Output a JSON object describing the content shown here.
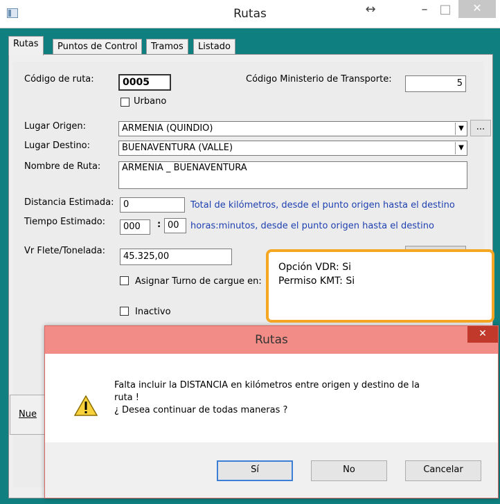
{
  "window": {
    "title": "Rutas",
    "resize_glyph": "↔",
    "minimize_glyph": "–",
    "maximize_glyph": "□",
    "close_glyph": "✕"
  },
  "tabs": [
    {
      "label": "Rutas"
    },
    {
      "label": "Puntos de Control"
    },
    {
      "label": "Tramos"
    },
    {
      "label": "Listado"
    }
  ],
  "form": {
    "codigo_ruta_label": "Código de ruta:",
    "codigo_ruta_value": "0005",
    "codigo_ministerio_label": "Código Ministerio de Transporte:",
    "codigo_ministerio_value": "5",
    "urbano_label": "Urbano",
    "lugar_origen_label": "Lugar Origen:",
    "lugar_origen_value": "ARMENIA  (QUINDIO)",
    "ellipsis_label": "...",
    "lugar_destino_label": "Lugar Destino:",
    "lugar_destino_value": "BUENAVENTURA  (VALLE)",
    "nombre_ruta_label": "Nombre de Ruta:",
    "nombre_ruta_value": "ARMENIA _ BUENAVENTURA",
    "distancia_label": "Distancia Estimada:",
    "distancia_value": "0",
    "distancia_help": "Total de kilómetros, desde el punto origen hasta el destino",
    "tiempo_label": "Tiempo Estimado:",
    "tiempo_horas": "000",
    "tiempo_sep": ":",
    "tiempo_minutos": "00",
    "tiempo_help": "horas:minutos, desde el punto origen hasta el destino",
    "flete_label": "Vr Flete/Tonelada:",
    "flete_value": "45.325,00",
    "asignar_turno_label": "Asignar Turno de cargue en:",
    "inactivo_label": "Inactivo",
    "nuevo_label": "Nue"
  },
  "tooltip": {
    "line1": "Opción VDR: Si",
    "line2": "Permiso KMT: Si"
  },
  "dialog": {
    "title": "Rutas",
    "close_glyph": "✕",
    "message_line1": "Falta incluir la DISTANCIA en kilómetros entre origen y destino de la",
    "message_line2": "ruta !",
    "message_line3": "¿ Desea continuar de todas maneras ?",
    "warning_glyph": "!",
    "buttons": {
      "si": "Sí",
      "no": "No",
      "cancelar": "Cancelar"
    }
  },
  "colors": {
    "accent_teal": "#107f7f",
    "dialog_title": "#f28c86",
    "tooltip_border": "#f5a623",
    "help_text": "#1e3fb0"
  }
}
